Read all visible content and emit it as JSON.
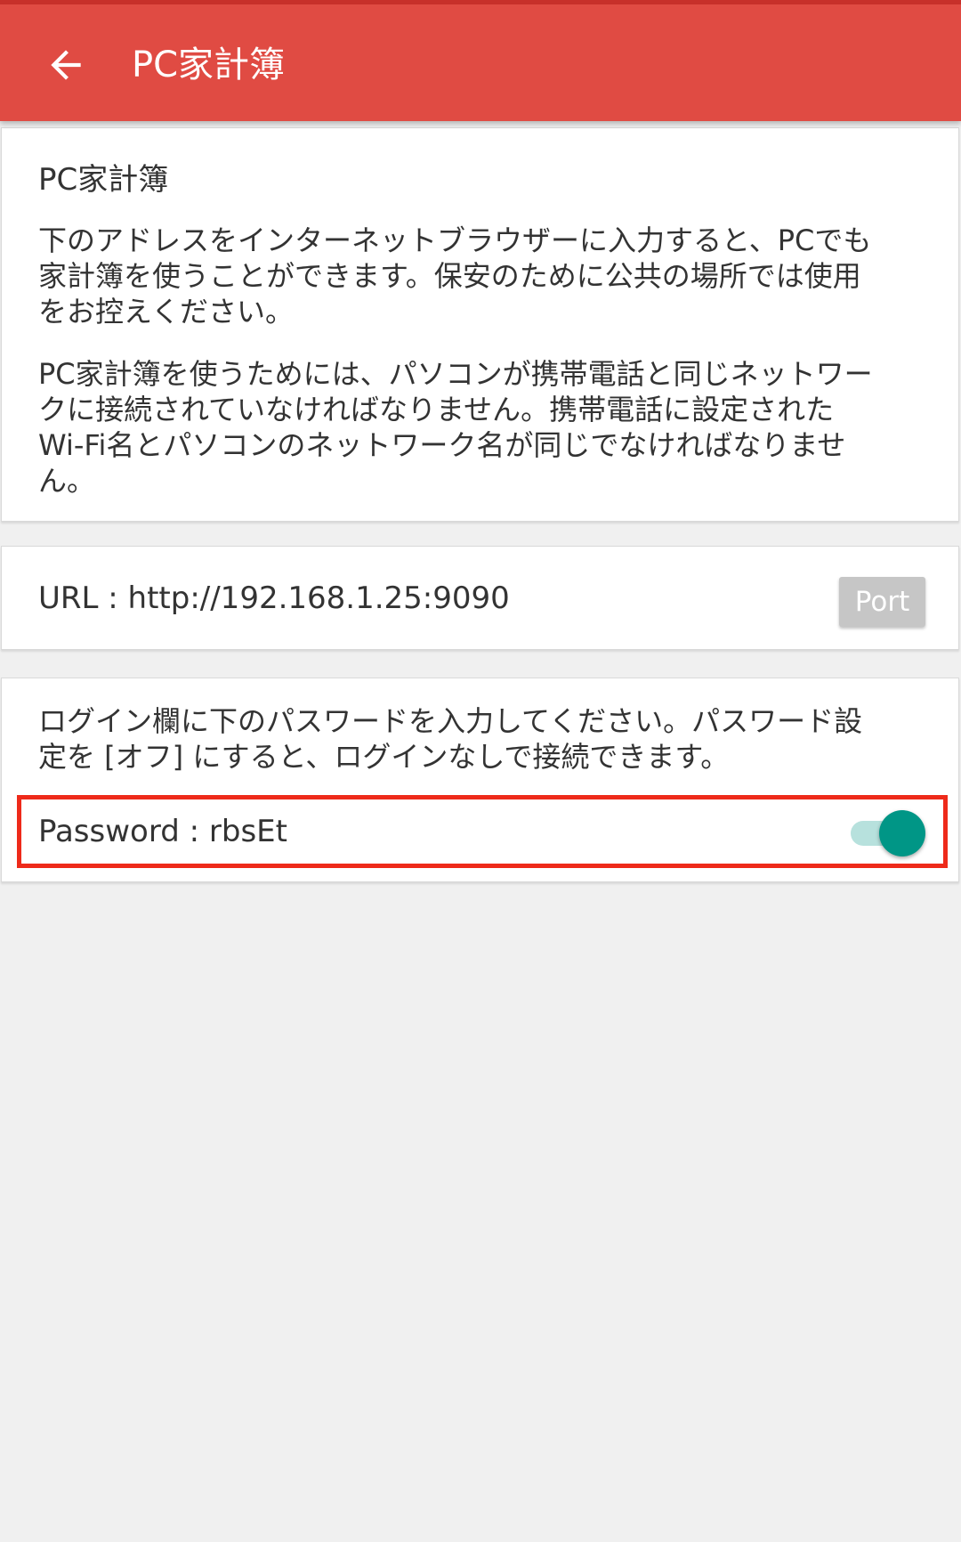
{
  "app_bar": {
    "back_icon": "arrow-left-icon",
    "title": "PC家計簿"
  },
  "info_card": {
    "title": "PC家計簿",
    "paragraph1_lines": [
      "下のアドレスをインターネットブラウザーに入力すると、PCでも",
      "家計簿を使うことができます。保安のために公共の場所では使用",
      "をお控えください。"
    ],
    "paragraph2_lines": [
      "PC家計簿を使うためには、パソコンが携帯電話と同じネットワー",
      "クに接続されていなければなりません。携帯電話に設定された",
      "Wi-Fi名とパソコンのネットワーク名が同じでなければなりませ",
      "ん。"
    ]
  },
  "url_card": {
    "url_text": "URL   : http://192.168.1.25:9090",
    "port_label": "Port"
  },
  "password_card": {
    "description_lines": [
      "ログイン欄に下のパスワードを入力してください。パスワード設",
      "定を [オフ] にすると、ログインなしで接続できます。"
    ],
    "password_text": "Password : rbsEt",
    "toggle_on": true
  },
  "colors": {
    "app_bar": "#e04b43",
    "highlight_border": "#ee2a1a",
    "switch_thumb": "#009686",
    "switch_track": "#b7e1dd",
    "port_button": "#c6c6c6"
  }
}
